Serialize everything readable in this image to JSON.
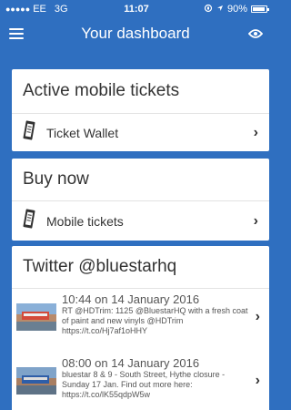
{
  "status_bar": {
    "carrier": "EE",
    "network": "3G",
    "time": "11:07",
    "battery": "90%"
  },
  "nav": {
    "title": "Your dashboard"
  },
  "cards": {
    "active_tickets": {
      "title": "Active mobile tickets",
      "item_label": "Ticket Wallet"
    },
    "buy_now": {
      "title": "Buy now",
      "item_label": "Mobile tickets"
    },
    "twitter": {
      "title": "Twitter @bluestarhq",
      "tweets": [
        {
          "date": "10:44 on 14 January 2016",
          "text": "RT @HDTrim: 1125 @BluestarHQ with a fresh coat of paint and new vinyls @HDTrim https://t.co/Hj7af1oHHY"
        },
        {
          "date": "08:00 on 14 January 2016",
          "text": "bluestar 8 & 9 - South Street, Hythe closure - Sunday 17 Jan. Find out more here: https://t.co/lK55qdpW5w"
        }
      ]
    }
  },
  "colors": {
    "background": "#2f6fc0",
    "card": "#ffffff"
  }
}
